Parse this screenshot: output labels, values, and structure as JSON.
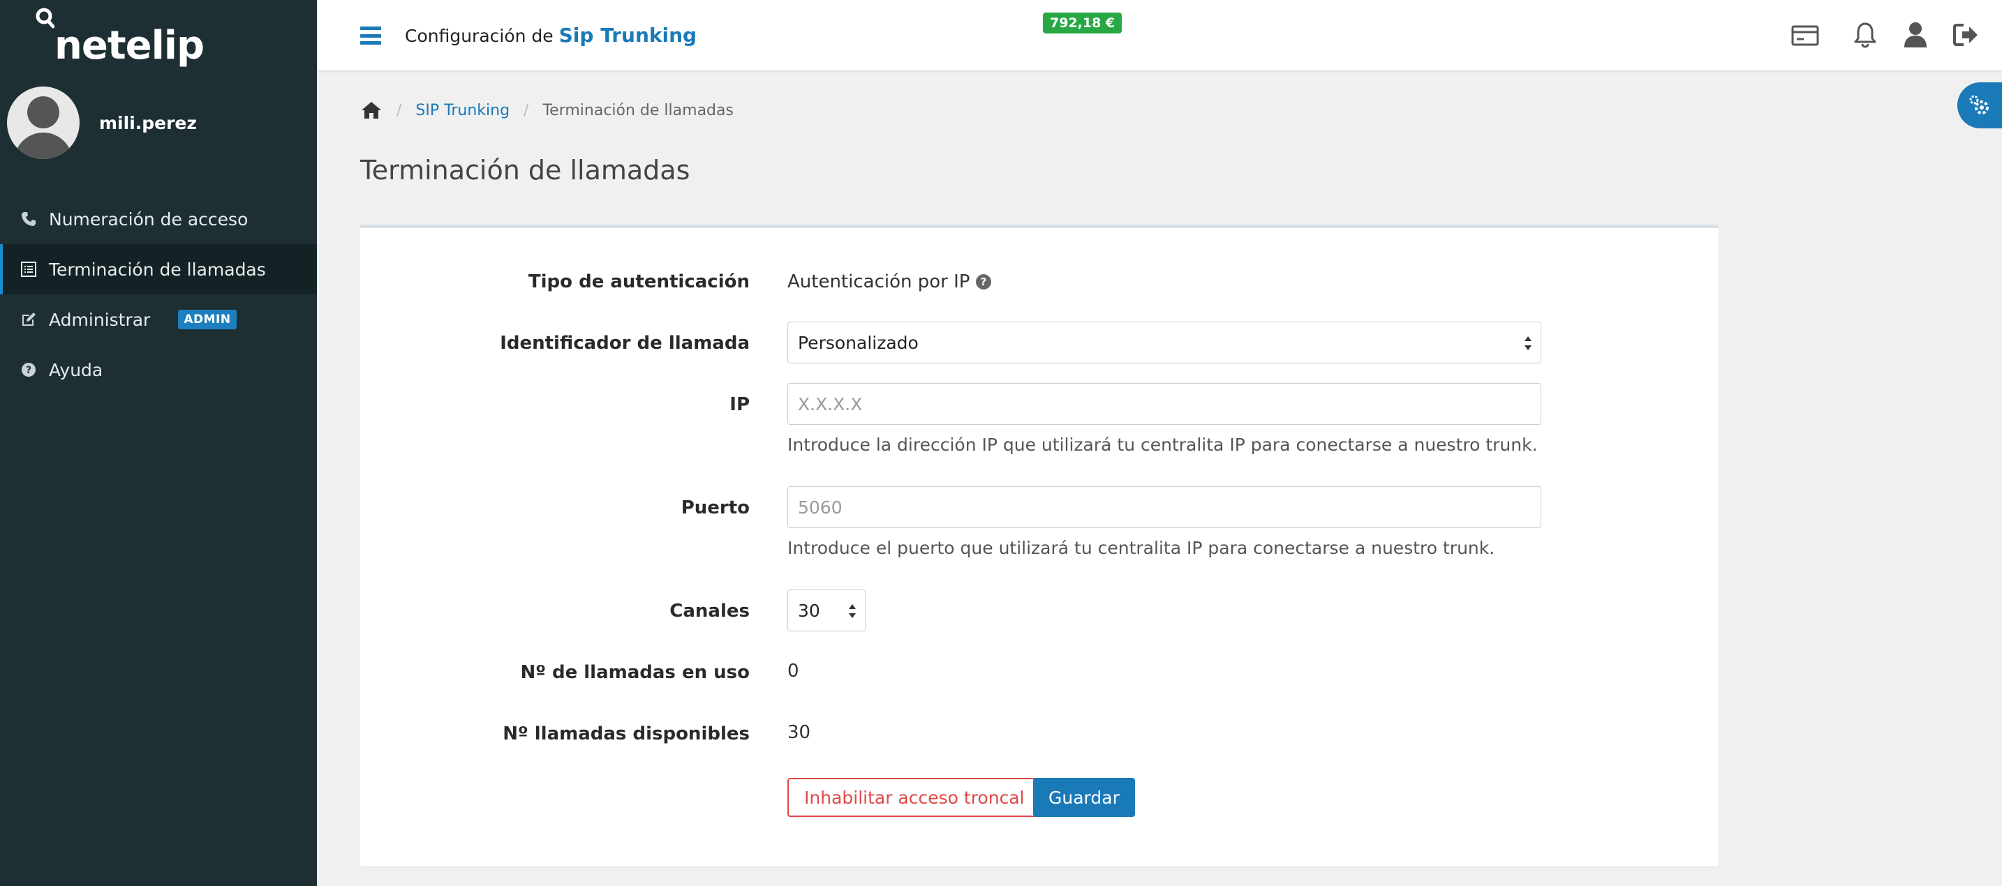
{
  "brand": {
    "name": "netelip"
  },
  "user": {
    "name": "mili.perez"
  },
  "sidebar": {
    "items": [
      {
        "label": "Numeración de acceso",
        "icon": "phone-icon"
      },
      {
        "label": "Terminación de llamadas",
        "icon": "list-icon",
        "active": true
      },
      {
        "label": "Administrar",
        "icon": "edit-icon",
        "badge": "ADMIN"
      },
      {
        "label": "Ayuda",
        "icon": "question-circle-icon"
      }
    ]
  },
  "header": {
    "title_prefix": "Configuración de",
    "title_accent": "Sip Trunking",
    "balance": "792,18 €",
    "icons": [
      "billing-card-icon",
      "bell-icon",
      "user-icon",
      "logout-icon"
    ]
  },
  "breadcrumb": {
    "home_icon": "home-icon",
    "link": "SIP Trunking",
    "current": "Terminación de llamadas"
  },
  "page": {
    "title": "Terminación de llamadas"
  },
  "form": {
    "auth_type": {
      "label": "Tipo de autenticación",
      "value": "Autenticación por IP",
      "icon": "question-circle-icon"
    },
    "caller_id": {
      "label": "Identificador de llamada",
      "value": "Personalizado"
    },
    "ip": {
      "label": "IP",
      "value": "",
      "placeholder": "X.X.X.X",
      "help": "Introduce la dirección IP que utilizará tu centralita IP para conectarse a nuestro trunk."
    },
    "port": {
      "label": "Puerto",
      "value": "",
      "placeholder": "5060",
      "help": "Introduce el puerto que utilizará tu centralita IP para conectarse a nuestro trunk."
    },
    "channels": {
      "label": "Canales",
      "value": "30"
    },
    "calls_in_use": {
      "label": "Nº de llamadas en uso",
      "value": "0"
    },
    "calls_available": {
      "label": "Nº llamadas disponibles",
      "value": "30"
    },
    "disable_button": "Inhabilitar acceso troncal",
    "save_button": "Guardar"
  },
  "colors": {
    "sidebar": "#1e2f33",
    "accent": "#1a7ab8",
    "danger": "#e04848",
    "balance": "#27a844"
  }
}
